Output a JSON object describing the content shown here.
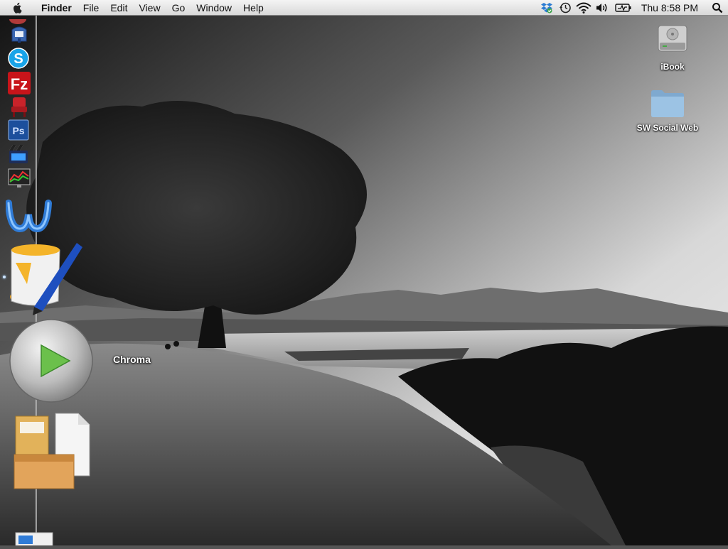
{
  "menubar": {
    "app_name": "Finder",
    "menus": [
      "File",
      "Edit",
      "View",
      "Go",
      "Window",
      "Help"
    ],
    "clock": "Thu 8:58 PM",
    "status_icons": [
      "dropbox-icon",
      "time-machine-icon",
      "wifi-icon",
      "volume-icon",
      "battery-icon"
    ]
  },
  "desktop": {
    "icons": [
      {
        "label": "iBook",
        "icon": "hard-drive-icon"
      },
      {
        "label": "SW Social Web",
        "icon": "folder-icon"
      }
    ]
  },
  "dock": {
    "tooltip": "Chroma",
    "items": [
      {
        "name": "mail-icon"
      },
      {
        "name": "skype-icon"
      },
      {
        "name": "filezilla-icon"
      },
      {
        "name": "movie-chair-icon"
      },
      {
        "name": "photoshop-icon"
      },
      {
        "name": "final-cut-icon"
      },
      {
        "name": "network-monitor-icon"
      },
      {
        "name": "word-icon"
      },
      {
        "name": "paint-bucket-icon"
      },
      {
        "name": "chroma-play-icon"
      },
      {
        "name": "archive-utility-icon"
      },
      {
        "name": "word-doc-icon"
      }
    ]
  },
  "colors": {
    "menubar_bg": "#e6e6e6",
    "folder_blue": "#8fb7d9",
    "play_green": "#6bc04b"
  }
}
